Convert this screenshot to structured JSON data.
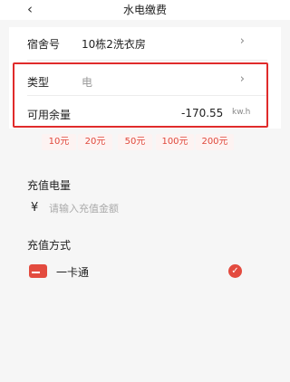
{
  "header": {
    "title": "水电缴费",
    "back_icon": "chevron-left-icon"
  },
  "dorm": {
    "label": "宿舍号",
    "value": "10栋2洗衣房"
  },
  "type_row": {
    "label": "类型",
    "value": "电"
  },
  "balance_row": {
    "label": "可用余量",
    "value": "-170.55",
    "unit": "kw.h"
  },
  "quick_amounts": [
    "10元",
    "20元",
    "50元",
    "100元",
    "200元"
  ],
  "recharge": {
    "label": "充值电量",
    "currency_symbol": "¥",
    "placeholder": "请输入充值金额",
    "value": ""
  },
  "payment": {
    "label": "充值方式",
    "method": "一卡通",
    "selected": true
  },
  "colors": {
    "accent": "#e34b3f",
    "highlight_border": "#e02b2b"
  }
}
